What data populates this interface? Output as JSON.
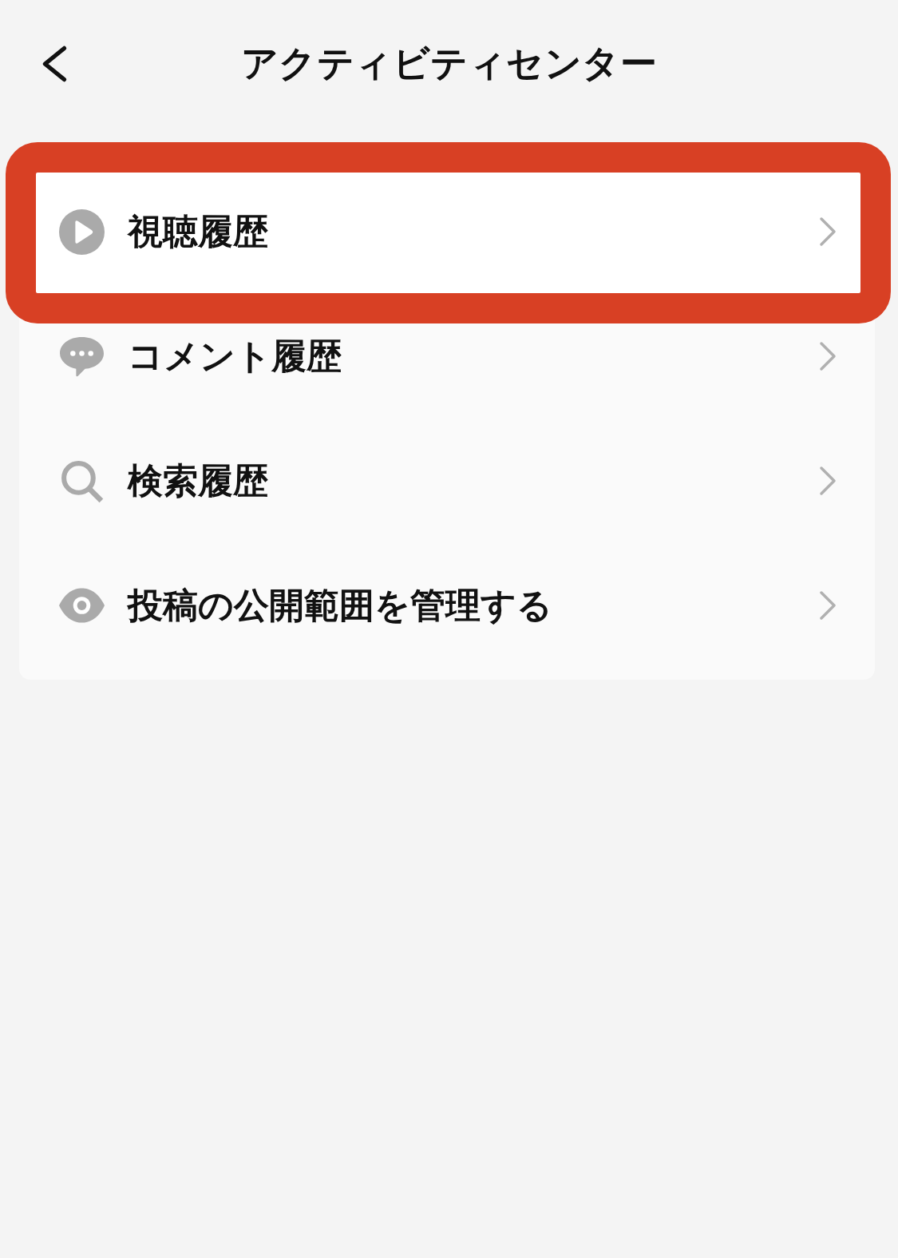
{
  "header": {
    "title": "アクティビティセンター"
  },
  "items": [
    {
      "kind": "play",
      "label": "視聴履歴",
      "highlighted": true
    },
    {
      "kind": "comment",
      "label": "コメント履歴",
      "highlighted": false
    },
    {
      "kind": "search",
      "label": "検索履歴",
      "highlighted": false
    },
    {
      "kind": "eye",
      "label": "投稿の公開範囲を管理する",
      "highlighted": false
    }
  ]
}
